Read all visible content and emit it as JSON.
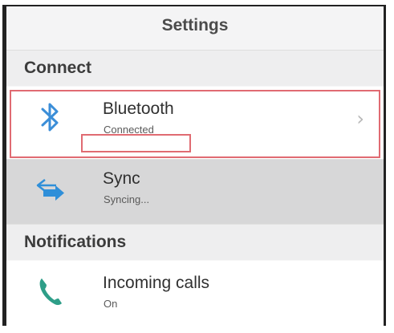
{
  "header": {
    "title": "Settings"
  },
  "sections": [
    {
      "title": "Connect"
    },
    {
      "title": "Notifications"
    }
  ],
  "rows": {
    "bluetooth": {
      "label": "Bluetooth",
      "status": "Connected",
      "chevron": "›",
      "icon": "bluetooth-icon",
      "icon_color": "#3b8ed8"
    },
    "sync": {
      "label": "Sync",
      "status": "Syncing...",
      "icon": "sync-icon",
      "icon_color": "#2f8fd9"
    },
    "incoming_calls": {
      "label": "Incoming calls",
      "status": "On",
      "icon": "phone-icon",
      "icon_color": "#2e9e88"
    }
  },
  "colors": {
    "annotation": "#e06b72",
    "highlight_row": "#d7d7d8"
  }
}
